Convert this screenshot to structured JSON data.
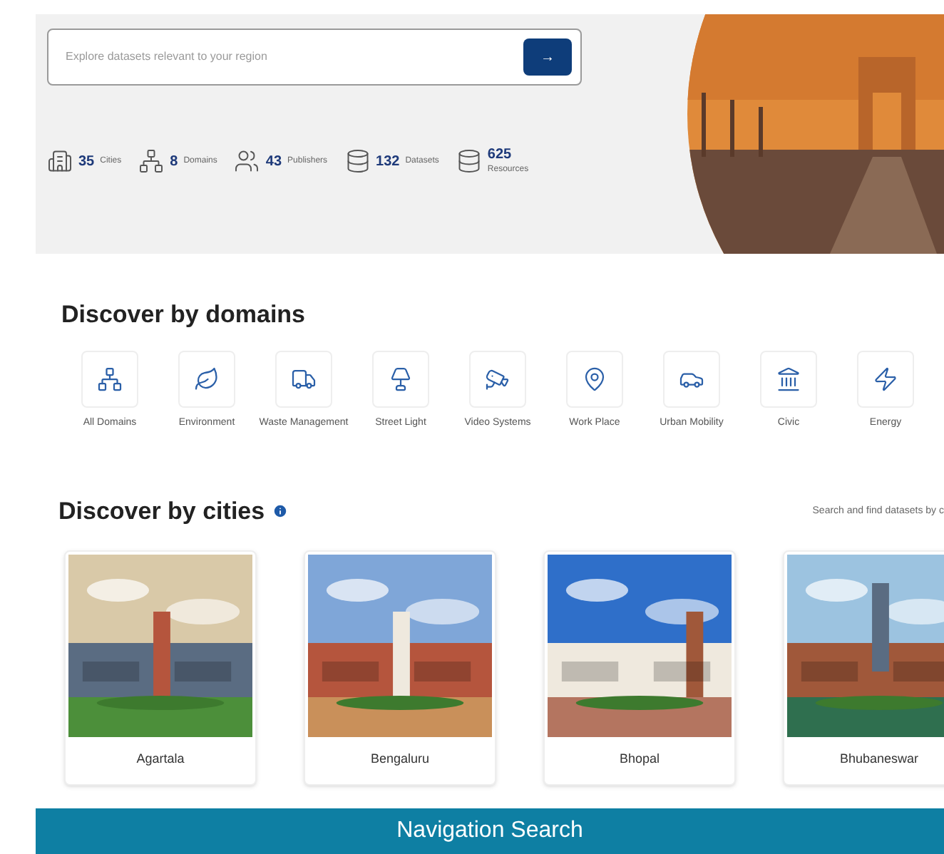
{
  "search": {
    "placeholder": "Explore datasets relevant to your region",
    "button": "→"
  },
  "stats": [
    {
      "kind": "cities",
      "value": "35",
      "label": "Cities"
    },
    {
      "kind": "domains",
      "value": "8",
      "label": "Domains"
    },
    {
      "kind": "publishers",
      "value": "43",
      "label": "Publishers"
    },
    {
      "kind": "datasets",
      "value": "132",
      "label": "Datasets"
    },
    {
      "kind": "resources",
      "value": "625",
      "label": "Resources"
    }
  ],
  "domains": {
    "title": "Discover by domains",
    "items": [
      {
        "kind": "all",
        "label": "All Domains"
      },
      {
        "kind": "environment",
        "label": "Environment"
      },
      {
        "kind": "waste",
        "label": "Waste Management"
      },
      {
        "kind": "street",
        "label": "Street Light"
      },
      {
        "kind": "video",
        "label": "Video Systems"
      },
      {
        "kind": "work",
        "label": "Work Place"
      },
      {
        "kind": "mobility",
        "label": "Urban Mobility"
      },
      {
        "kind": "civic",
        "label": "Civic"
      },
      {
        "kind": "energy",
        "label": "Energy"
      }
    ]
  },
  "cities": {
    "title": "Discover by cities",
    "hint": "Search and find datasets by c",
    "items": [
      {
        "name": "Agartala",
        "kind": "picture"
      },
      {
        "name": "Bengaluru",
        "kind": "picture"
      },
      {
        "name": "Bhopal",
        "kind": "picture"
      },
      {
        "name": "Bhubaneswar",
        "kind": "picture"
      }
    ]
  },
  "banner": "Navigation Search"
}
